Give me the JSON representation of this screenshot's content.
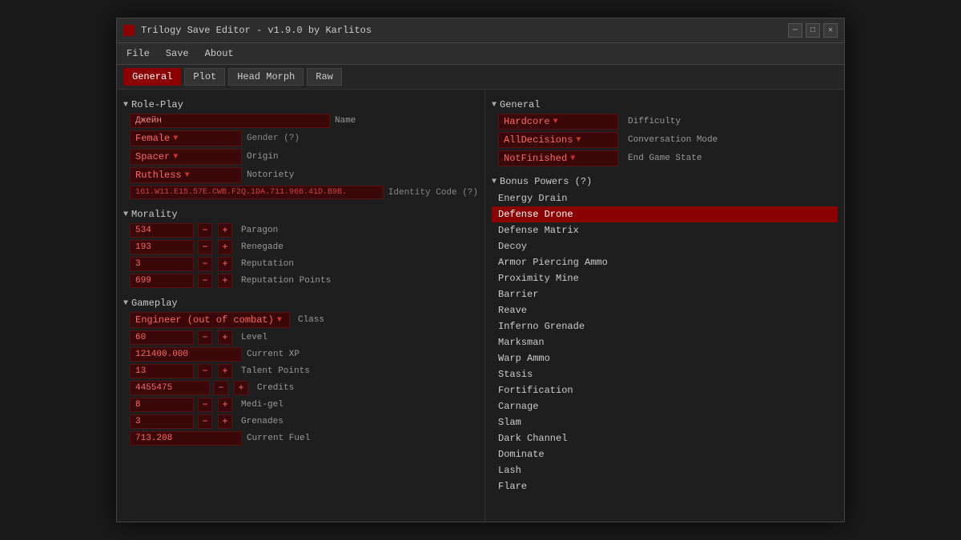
{
  "window": {
    "title": "Trilogy Save Editor - v1.9.0 by Karlitos",
    "icon": "▣"
  },
  "menubar": {
    "items": [
      "File",
      "Save",
      "About"
    ]
  },
  "tabs": [
    {
      "label": "General",
      "active": true
    },
    {
      "label": "Plot",
      "active": false
    },
    {
      "label": "Head Morph",
      "active": false
    },
    {
      "label": "Raw",
      "active": false
    }
  ],
  "left": {
    "roleplay": {
      "header": "Role-Play",
      "name_value": "Джейн",
      "name_label": "Name",
      "gender_value": "Female",
      "gender_label": "Gender (?)",
      "origin_value": "Spacer",
      "origin_label": "Origin",
      "notoriety_value": "Ruthless",
      "notoriety_label": "Notoriety",
      "identity_value": "161.W11.E15.57E.CWB.F2Q.1DA.711.966.41D.B9B.",
      "identity_label": "Identity Code (?)"
    },
    "morality": {
      "header": "Morality",
      "paragon_value": "534",
      "paragon_label": "Paragon",
      "renegade_value": "193",
      "renegade_label": "Renegade",
      "reputation_value": "3",
      "reputation_label": "Reputation",
      "rep_points_value": "699",
      "rep_points_label": "Reputation Points"
    },
    "gameplay": {
      "header": "Gameplay",
      "class_value": "Engineer (out of combat)",
      "class_label": "Class",
      "level_value": "60",
      "level_label": "Level",
      "xp_value": "121400.000",
      "xp_label": "Current XP",
      "talent_value": "13",
      "talent_label": "Talent Points",
      "credits_value": "4455475",
      "credits_label": "Credits",
      "medigel_value": "8",
      "medigel_label": "Medi-gel",
      "grenades_value": "3",
      "grenades_label": "Grenades",
      "fuel_value": "713.208",
      "fuel_label": "Current Fuel"
    }
  },
  "right": {
    "general": {
      "header": "General",
      "difficulty_value": "Hardcore",
      "difficulty_label": "Difficulty",
      "conversation_value": "AllDecisions",
      "conversation_label": "Conversation Mode",
      "endgame_value": "NotFinished",
      "endgame_label": "End Game State"
    },
    "bonus_powers": {
      "header": "Bonus Powers (?)",
      "items": [
        {
          "label": "Energy Drain",
          "selected": false
        },
        {
          "label": "Defense Drone",
          "selected": true
        },
        {
          "label": "Defense Matrix",
          "selected": false
        },
        {
          "label": "Decoy",
          "selected": false
        },
        {
          "label": "Armor Piercing Ammo",
          "selected": false
        },
        {
          "label": "Proximity Mine",
          "selected": false
        },
        {
          "label": "Barrier",
          "selected": false
        },
        {
          "label": "Reave",
          "selected": false
        },
        {
          "label": "Inferno Grenade",
          "selected": false
        },
        {
          "label": "Marksman",
          "selected": false
        },
        {
          "label": "Warp Ammo",
          "selected": false
        },
        {
          "label": "Stasis",
          "selected": false
        },
        {
          "label": "Fortification",
          "selected": false
        },
        {
          "label": "Carnage",
          "selected": false
        },
        {
          "label": "Slam",
          "selected": false
        },
        {
          "label": "Dark Channel",
          "selected": false
        },
        {
          "label": "Dominate",
          "selected": false
        },
        {
          "label": "Lash",
          "selected": false
        },
        {
          "label": "Flare",
          "selected": false
        }
      ]
    }
  }
}
